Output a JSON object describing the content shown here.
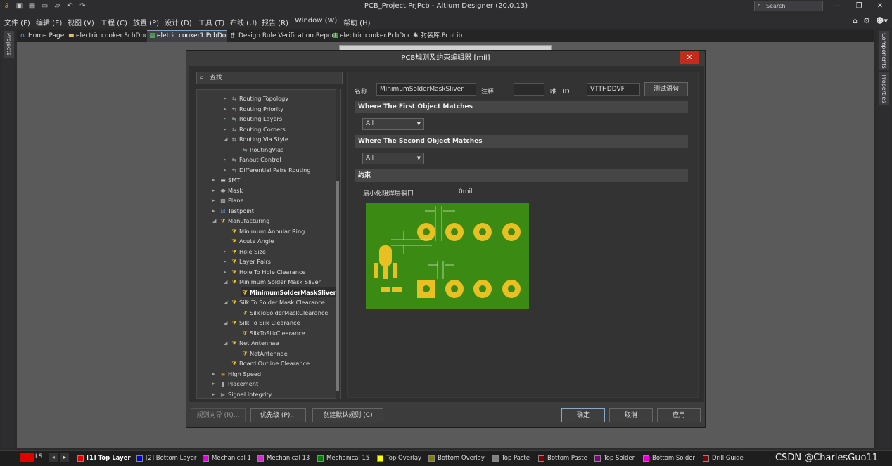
{
  "window": {
    "title": "PCB_Project.PrjPcb - Altium Designer (20.0.13)",
    "search_placeholder": "Search"
  },
  "menu": [
    "文件 (F)",
    "编辑 (E)",
    "视图 (V)",
    "工程 (C)",
    "放置 (P)",
    "设计 (D)",
    "工具 (T)",
    "布线 (U)",
    "报告 (R)",
    "Window (W)",
    "帮助 (H)"
  ],
  "tabs": [
    {
      "label": "Home Page",
      "icon": "home-icon"
    },
    {
      "label": "electric cooker.SchDoc *",
      "icon": "schematic-icon"
    },
    {
      "label": "eletric cooker1.PcbDoc *",
      "icon": "pcb-icon",
      "active": true
    },
    {
      "label": "Design Rule Verification Report",
      "icon": "report-icon"
    },
    {
      "label": "electric cooker.PcbDoc *",
      "icon": "pcb-icon"
    },
    {
      "label": "封装库.PcbLib",
      "icon": "library-icon"
    }
  ],
  "side_panels": {
    "left": "Projects",
    "right_top": "Components",
    "right_bottom": "Properties"
  },
  "dialog": {
    "title": "PCB规则及约束编辑器 [mil]",
    "close_label": "✕",
    "search_placeholder": "查找",
    "tree": [
      {
        "label": "Routing Topology",
        "indent": 3,
        "expander": "▸",
        "icon": "rule-icon"
      },
      {
        "label": "Routing Priority",
        "indent": 3,
        "expander": "▸",
        "icon": "rule-icon"
      },
      {
        "label": "Routing Layers",
        "indent": 3,
        "expander": "▸",
        "icon": "rule-icon"
      },
      {
        "label": "Routing Corners",
        "indent": 3,
        "expander": "▸",
        "icon": "rule-icon"
      },
      {
        "label": "Routing Via Style",
        "indent": 3,
        "expander": "◢",
        "icon": "rule-icon"
      },
      {
        "label": "RoutingVias",
        "indent": 4,
        "expander": "",
        "icon": "rule-icon"
      },
      {
        "label": "Fanout Control",
        "indent": 3,
        "expander": "▸",
        "icon": "rule-icon"
      },
      {
        "label": "Differential Pairs Routing",
        "indent": 3,
        "expander": "▸",
        "icon": "rule-icon"
      },
      {
        "label": "SMT",
        "indent": 2,
        "expander": "▸",
        "icon": "smt-icon"
      },
      {
        "label": "Mask",
        "indent": 2,
        "expander": "▸",
        "icon": "mask-icon"
      },
      {
        "label": "Plane",
        "indent": 2,
        "expander": "▸",
        "icon": "plane-icon"
      },
      {
        "label": "Testpoint",
        "indent": 2,
        "expander": "▸",
        "icon": "testpoint-icon"
      },
      {
        "label": "Manufacturing",
        "indent": 2,
        "expander": "◢",
        "icon": "manufacturing-icon"
      },
      {
        "label": "Minimum Annular Ring",
        "indent": 3,
        "expander": "",
        "icon": "rule-icon"
      },
      {
        "label": "Acute Angle",
        "indent": 3,
        "expander": "",
        "icon": "rule-icon"
      },
      {
        "label": "Hole Size",
        "indent": 3,
        "expander": "▸",
        "icon": "rule-icon"
      },
      {
        "label": "Layer Pairs",
        "indent": 3,
        "expander": "▸",
        "icon": "rule-icon"
      },
      {
        "label": "Hole To Hole Clearance",
        "indent": 3,
        "expander": "▸",
        "icon": "rule-icon"
      },
      {
        "label": "Minimum Solder Mask Sliver",
        "indent": 3,
        "expander": "◢",
        "icon": "rule-icon"
      },
      {
        "label": "MinimumSolderMaskSliver*",
        "indent": 4,
        "expander": "",
        "icon": "rule-icon",
        "selected": true
      },
      {
        "label": "Silk To Solder Mask Clearance",
        "indent": 3,
        "expander": "◢",
        "icon": "rule-icon"
      },
      {
        "label": "SilkToSolderMaskClearance",
        "indent": 4,
        "expander": "",
        "icon": "rule-icon"
      },
      {
        "label": "Silk To Silk Clearance",
        "indent": 3,
        "expander": "◢",
        "icon": "rule-icon"
      },
      {
        "label": "SilkToSilkClearance",
        "indent": 4,
        "expander": "",
        "icon": "rule-icon"
      },
      {
        "label": "Net Antennae",
        "indent": 3,
        "expander": "◢",
        "icon": "rule-icon"
      },
      {
        "label": "NetAntennae",
        "indent": 4,
        "expander": "",
        "icon": "rule-icon"
      },
      {
        "label": "Board Outline Clearance",
        "indent": 3,
        "expander": "",
        "icon": "rule-icon"
      },
      {
        "label": "High Speed",
        "indent": 2,
        "expander": "▸",
        "icon": "highspeed-icon"
      },
      {
        "label": "Placement",
        "indent": 2,
        "expander": "▸",
        "icon": "placement-icon"
      },
      {
        "label": "Signal Integrity",
        "indent": 2,
        "expander": "▸",
        "icon": "signal-icon"
      }
    ],
    "rule": {
      "name_label": "名称",
      "name_value": "MinimumSolderMaskSliver",
      "comment_label": "注释",
      "comment_value": "",
      "uid_label": "唯一ID",
      "uid_value": "VTTHDDVF",
      "test_button": "测试语句",
      "first_match_header": "Where The First Object Matches",
      "first_match_value": "All",
      "second_match_header": "Where The Second Object Matches",
      "second_match_value": "All",
      "constraints_header": "约束",
      "constraint_label": "最小化阻焊层裂口",
      "constraint_value": "0mil"
    },
    "buttons": {
      "wizard": "规则向导 (R)...",
      "priority": "优先级 (P)...",
      "create_default": "创建默认规则 (C)",
      "ok": "确定",
      "cancel": "取消",
      "apply": "应用"
    }
  },
  "status_bar": {
    "ls_label": "LS",
    "layers": [
      {
        "label": "[1] Top Layer",
        "color": "#e00000",
        "active": true
      },
      {
        "label": "[2] Bottom Layer",
        "color": "#0000e0"
      },
      {
        "label": "Mechanical 1",
        "color": "#e000e0"
      },
      {
        "label": "Mechanical 13",
        "color": "#d030d0"
      },
      {
        "label": "Mechanical 15",
        "color": "#008000"
      },
      {
        "label": "Top Overlay",
        "color": "#ffff00"
      },
      {
        "label": "Bottom Overlay",
        "color": "#808000"
      },
      {
        "label": "Top Paste",
        "color": "#808080"
      },
      {
        "label": "Bottom Paste",
        "color": "#800000"
      },
      {
        "label": "Top Solder",
        "color": "#800080"
      },
      {
        "label": "Bottom Solder",
        "color": "#e000e0"
      },
      {
        "label": "Drill Guide",
        "color": "#800000"
      }
    ],
    "watermark": "CSDN @CharlesGuo11"
  },
  "colors": {
    "pcb_board": "#3a8a13",
    "pcb_pad": "#e8c021",
    "accent_tab": "#7fa3c7",
    "close_red": "#c42b1c"
  }
}
